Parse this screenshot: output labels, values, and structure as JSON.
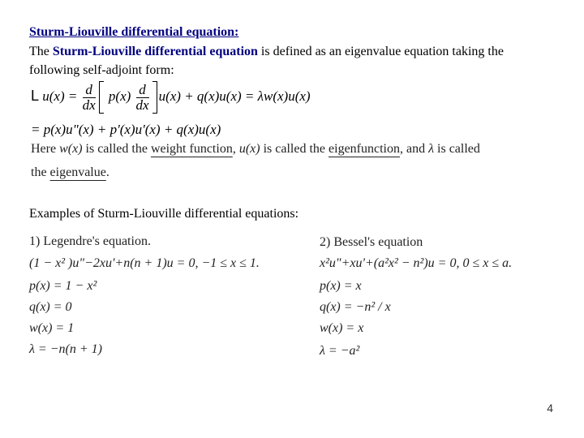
{
  "slide": {
    "title": "Sturm-Liouville differential equation:",
    "intro": {
      "prefix": "The ",
      "highlight": "Sturm-Liouville differential equation",
      "suffix": " is defined as an eigenvalue equation taking the following self-adjoint form:"
    },
    "equations": {
      "operator": "L",
      "lhs": "u(x) =",
      "frac_num": "d",
      "frac_den": "dx",
      "inner_p": "p(x)",
      "after_bracket": "u(x) + q(x)u(x) = λw(x)u(x)",
      "line2": "= p(x)u\"(x) + p'(x)u'(x) + q(x)u(x)"
    },
    "description": {
      "part1": "Here ",
      "w": "w(x)",
      "part2": " is called the ",
      "weight_function": "weight function",
      "part3": ", ",
      "u": "u(x)",
      "part4": " is called the ",
      "eigenfunction": "eigenfunction",
      "part5": ", and ",
      "lambda": "λ",
      "part6": " is called",
      "line2_prefix": "the ",
      "eigenvalue": "eigenvalue",
      "line2_suffix": "."
    },
    "examples_heading": "Examples of Sturm-Liouville differential equations:",
    "examples": [
      {
        "heading": "1) Legendre's equation.",
        "equation": "(1 − x² )u\"−2xu'+n(n + 1)u = 0,  −1 ≤ x ≤ 1.",
        "p": "p(x) = 1 − x²",
        "q": "q(x) = 0",
        "w": "w(x) = 1",
        "lambda": "λ = −n(n + 1)"
      },
      {
        "heading": "2) Bessel's equation",
        "equation": "x²u\"+xu'+(a²x² − n²)u = 0, 0 ≤ x ≤ a.",
        "p": "p(x) = x",
        "q": "q(x) = −n² / x",
        "w": "w(x) = x",
        "lambda": "λ = −a²"
      }
    ],
    "page_number": "4"
  }
}
